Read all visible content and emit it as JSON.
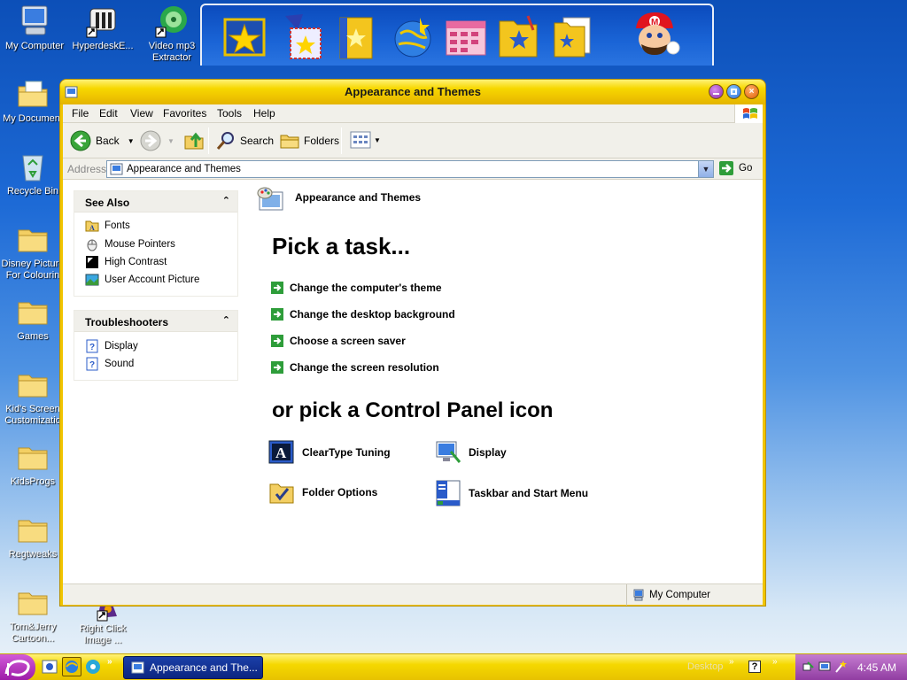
{
  "desktop": {
    "icons": [
      {
        "label": "My Computer"
      },
      {
        "label": "HyperdeskE..."
      },
      {
        "label": "Video mp3 Extractor"
      },
      {
        "label": "My Document"
      },
      {
        "label": "Recycle Bin"
      },
      {
        "label": "Disney Picture For Colourin"
      },
      {
        "label": "Games"
      },
      {
        "label": "Kid's Screen Customizatio"
      },
      {
        "label": "KidsProgs"
      },
      {
        "label": "Regtweaks"
      },
      {
        "label": "Tom&Jerry Cartoon..."
      },
      {
        "label": "Right Click Image ..."
      }
    ]
  },
  "window": {
    "title": "Appearance and Themes",
    "menu": [
      "File",
      "Edit",
      "View",
      "Favorites",
      "Tools",
      "Help"
    ],
    "toolbar": {
      "back": "Back",
      "search": "Search",
      "folders": "Folders"
    },
    "address": {
      "label": "Address",
      "value": "Appearance and Themes",
      "go": "Go"
    },
    "header_title": "Appearance and Themes",
    "see_also": {
      "title": "See Also",
      "items": [
        "Fonts",
        "Mouse Pointers",
        "High Contrast",
        "User Account Picture"
      ]
    },
    "troubleshooters": {
      "title": "Troubleshooters",
      "items": [
        "Display",
        "Sound"
      ]
    },
    "pick_task_heading": "Pick a task...",
    "tasks": [
      "Change the computer's theme",
      "Change the desktop background",
      "Choose a screen saver",
      "Change the screen resolution"
    ],
    "cp_heading": "or pick a Control Panel icon",
    "cp_icons": [
      "ClearType Tuning",
      "Display",
      "Folder Options",
      "Taskbar and Start Menu"
    ],
    "status_right": "My Computer"
  },
  "taskbar": {
    "active_button": "Appearance and The...",
    "desktop_label": "Desktop",
    "clock": "4:45 AM"
  }
}
